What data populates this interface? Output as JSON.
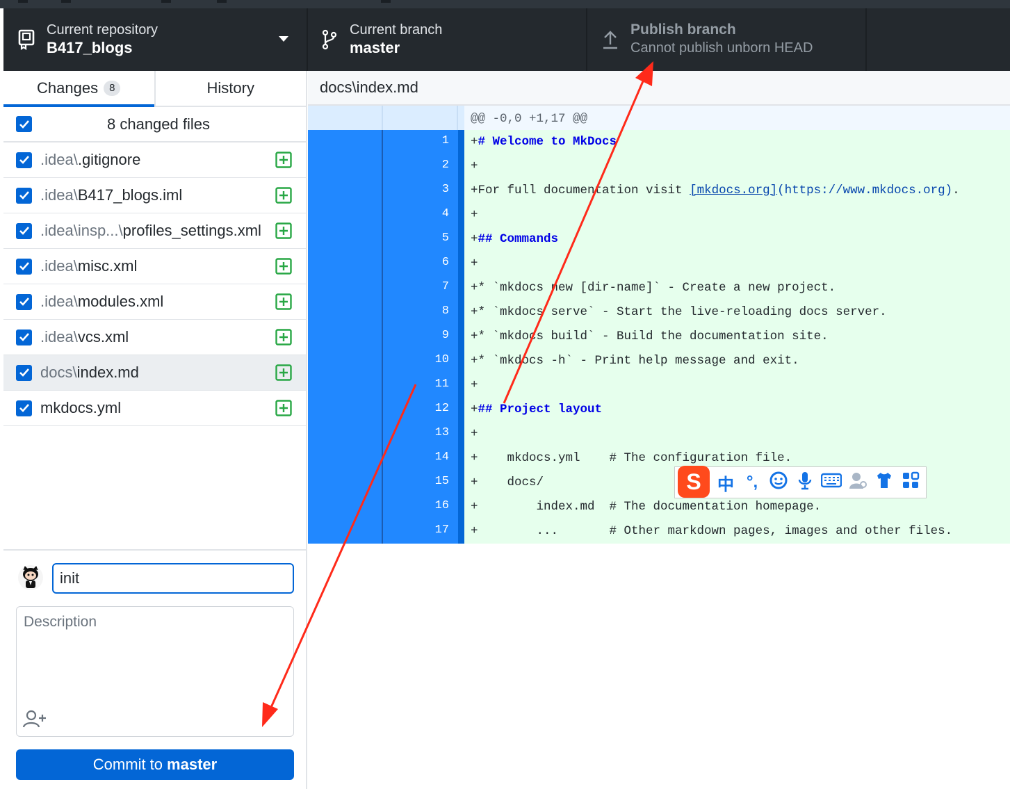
{
  "toolbar": {
    "repo_label": "Current repository",
    "repo_name": "B417_blogs",
    "branch_label": "Current branch",
    "branch_name": "master",
    "publish_label": "Publish branch",
    "publish_sub": "Cannot publish unborn HEAD"
  },
  "tabs": {
    "changes_label": "Changes",
    "changes_count": "8",
    "history_label": "History"
  },
  "changes": {
    "all_label": "8 changed files",
    "files": [
      {
        "dir": ".idea\\",
        "name": ".gitignore"
      },
      {
        "dir": ".idea\\",
        "name": "B417_blogs.iml"
      },
      {
        "dir": ".idea\\insp...\\",
        "name": "profiles_settings.xml"
      },
      {
        "dir": ".idea\\",
        "name": "misc.xml"
      },
      {
        "dir": ".idea\\",
        "name": "modules.xml"
      },
      {
        "dir": ".idea\\",
        "name": "vcs.xml"
      },
      {
        "dir": "docs\\",
        "name": "index.md"
      },
      {
        "dir": "",
        "name": "mkdocs.yml"
      }
    ]
  },
  "commit": {
    "summary_value": "init",
    "description_placeholder": "Description",
    "button_prefix": "Commit to",
    "button_branch": "master"
  },
  "diff": {
    "file_path": "docs\\index.md",
    "hunk_header": "@@ -0,0 +1,17 @@",
    "lines": [
      {
        "n": "1",
        "t": "+# Welcome to MkDocs"
      },
      {
        "n": "2",
        "t": "+"
      },
      {
        "n": "3",
        "t": "+For full documentation visit [mkdocs.org](https://www.mkdocs.org)."
      },
      {
        "n": "4",
        "t": "+"
      },
      {
        "n": "5",
        "t": "+## Commands"
      },
      {
        "n": "6",
        "t": "+"
      },
      {
        "n": "7",
        "t": "+* `mkdocs new [dir-name]` - Create a new project."
      },
      {
        "n": "8",
        "t": "+* `mkdocs serve` - Start the live-reloading docs server."
      },
      {
        "n": "9",
        "t": "+* `mkdocs build` - Build the documentation site."
      },
      {
        "n": "10",
        "t": "+* `mkdocs -h` - Print help message and exit."
      },
      {
        "n": "11",
        "t": "+"
      },
      {
        "n": "12",
        "t": "+## Project layout"
      },
      {
        "n": "13",
        "t": "+"
      },
      {
        "n": "14",
        "t": "+    mkdocs.yml    # The configuration file."
      },
      {
        "n": "15",
        "t": "+    docs/"
      },
      {
        "n": "16",
        "t": "+        index.md  # The documentation homepage."
      },
      {
        "n": "17",
        "t": "+        ...       # Other markdown pages, images and other files."
      }
    ]
  },
  "ime": {
    "logo": "S",
    "lang": "中",
    "punct": "°,"
  },
  "colors": {
    "accent": "#0366d6",
    "toolbar_bg": "#24292e",
    "added_bg": "#e6ffed",
    "annotation": "#ff2a1a"
  }
}
